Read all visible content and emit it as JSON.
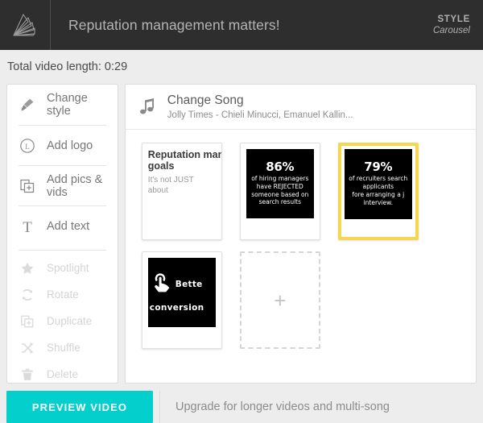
{
  "header": {
    "logo_icon": "fan-logo-icon",
    "title": "Reputation management matters!",
    "style_label": "STYLE",
    "style_value": "Carousel"
  },
  "length_bar": {
    "text": "Total video length: 0:29"
  },
  "sidebar": {
    "items": [
      {
        "label": "Change style",
        "icon": "paintbrush-icon",
        "disabled": false
      },
      {
        "label": "Add logo",
        "icon": "circled-l-icon",
        "disabled": false
      },
      {
        "label": "Add pics & vids",
        "icon": "add-media-icon",
        "disabled": false
      },
      {
        "label": "Add text",
        "icon": "text-t-icon",
        "disabled": false
      },
      {
        "label": "Spotlight",
        "icon": "star-icon",
        "disabled": true
      },
      {
        "label": "Rotate",
        "icon": "rotate-icon",
        "disabled": true
      },
      {
        "label": "Duplicate",
        "icon": "duplicate-icon",
        "disabled": true
      },
      {
        "label": "Shuffle",
        "icon": "shuffle-icon",
        "disabled": true
      },
      {
        "label": "Delete",
        "icon": "trash-icon",
        "disabled": true
      }
    ]
  },
  "song": {
    "icon": "music-note-icon",
    "title": "Change Song",
    "subtitle": "Jolly Times - Chieli Minucci, Emanuel Kallin..."
  },
  "scenes": [
    {
      "type": "text-card",
      "title": "Reputation managemen",
      "title_line2": "goals",
      "subtitle": "It's not JUST",
      "subtitle_line2": "about",
      "selected": false
    },
    {
      "type": "stat-card",
      "percent": "86%",
      "line1": "of hiring managers",
      "line2": "have REJECTED",
      "line3": "someone based on",
      "line4": "search results",
      "selected": false
    },
    {
      "type": "stat-card",
      "percent": "79%",
      "line1": "of recruiters search",
      "line2": "applicants",
      "line3": "fore arranging a j",
      "line4": "interview.",
      "selected": true
    },
    {
      "type": "icon-card",
      "icon": "tap-hand-icon",
      "line1": "Bette",
      "line2": "conversion",
      "selected": false
    },
    {
      "type": "placeholder",
      "icon": "plus-icon",
      "label": "+"
    }
  ],
  "footer": {
    "preview_label": "PREVIEW VIDEO",
    "upgrade_text": "Upgrade for longer videos and multi-song"
  },
  "colors": {
    "header_bg": "#2e2e2e",
    "accent_teal": "#03d0cc",
    "selected_yellow": "#f5d652",
    "page_bg": "#ededed"
  }
}
